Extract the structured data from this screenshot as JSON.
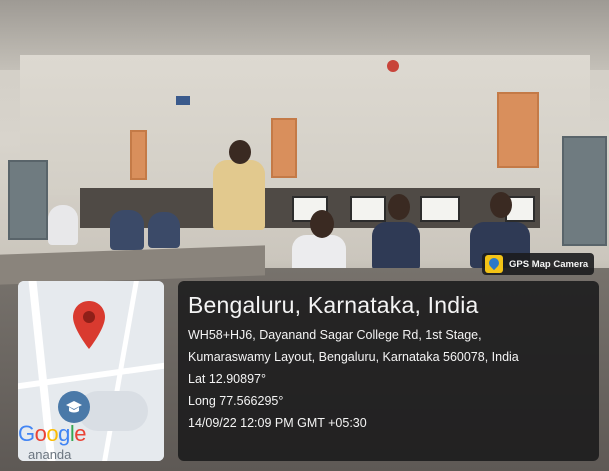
{
  "badge": {
    "label": "GPS Map Camera",
    "icon": "gps-map-camera-icon"
  },
  "location": {
    "title": "Bengaluru, Karnataka, India",
    "address_line_1": "WH58+HJ6, Dayanand Sagar College Rd, 1st Stage,",
    "address_line_2": "Kumaraswamy Layout, Bengaluru, Karnataka 560078, India",
    "lat": "Lat 12.90897°",
    "long": "Long 77.566295°",
    "timestamp": "14/09/22 12:09 PM GMT +05:30"
  },
  "map": {
    "brand": "Google",
    "partial_label": "anandа",
    "pin_color": "#d93a2f"
  }
}
